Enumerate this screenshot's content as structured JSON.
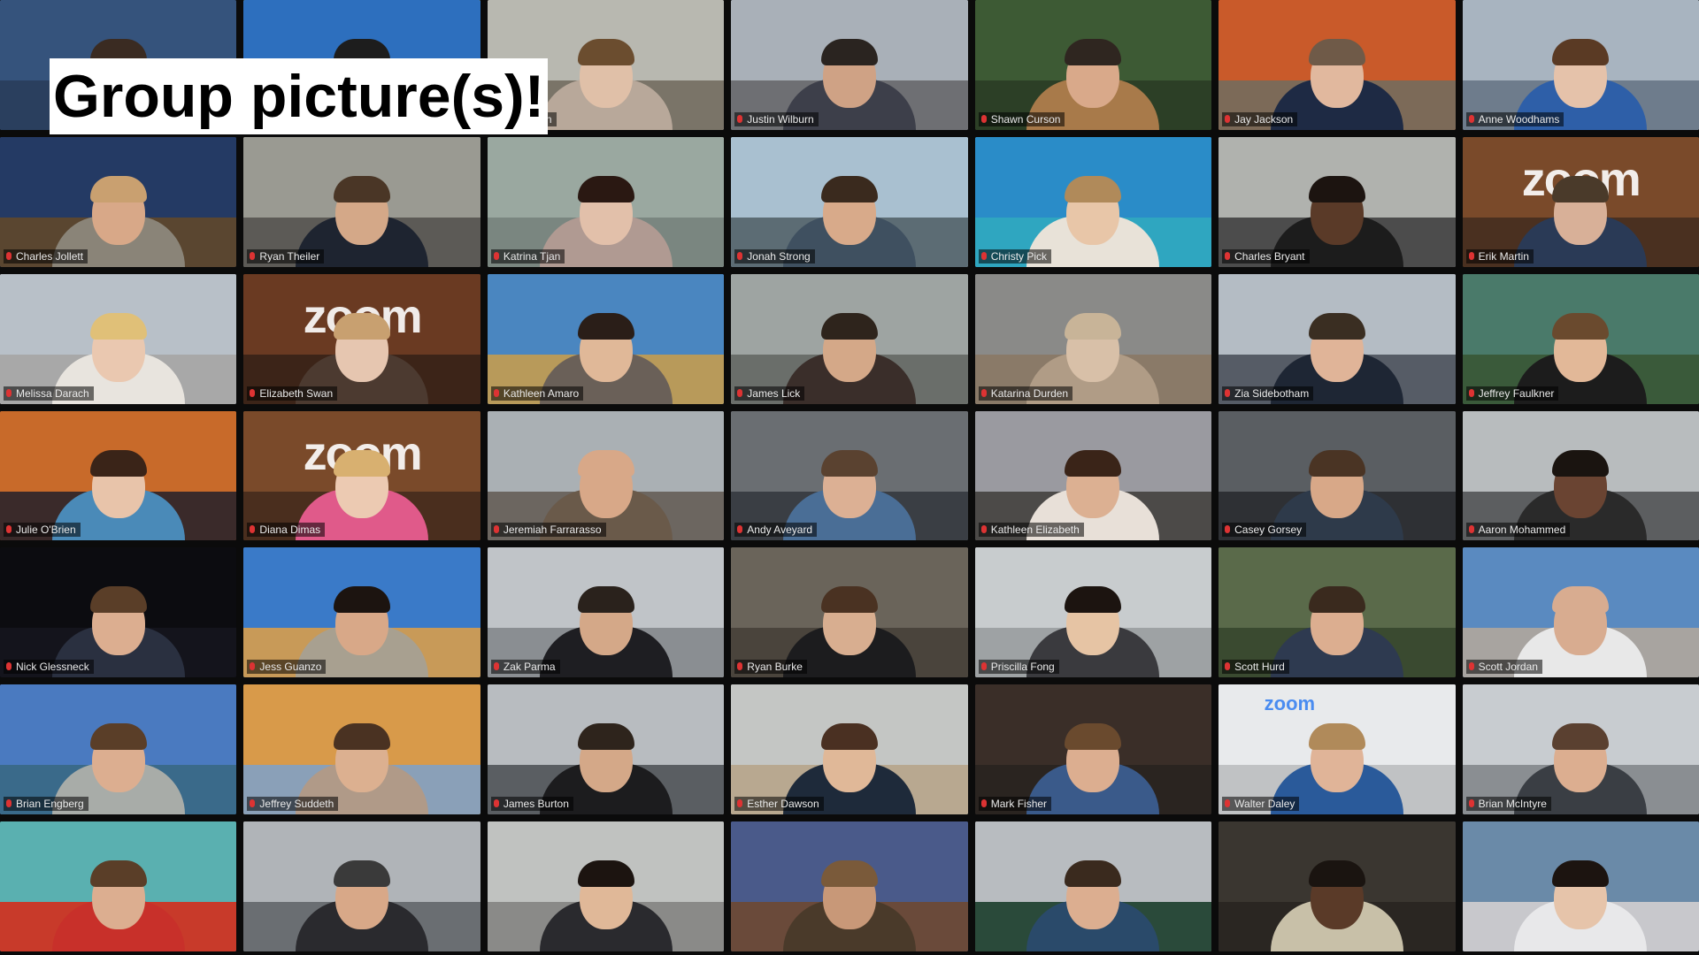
{
  "caption": "Group picture(s)!",
  "brand_text": "zoom",
  "accent_color": "#d8e23a",
  "grid": {
    "columns": 7,
    "rows": 7,
    "active_index": 1,
    "tiles": [
      {
        "name": "",
        "bg": "#35537c",
        "floor": "#2a3f5e",
        "skin": "#d9b09a",
        "hair": "#3a2b22",
        "shirt": "#2b2b30"
      },
      {
        "name": "",
        "bg": "#2d6fbe",
        "floor": "#23538c",
        "skin": "#d4a88c",
        "hair": "#1d1d1d",
        "shirt": "#f2f2f2"
      },
      {
        "name": "Hansagen",
        "bg": "#b8b8b0",
        "floor": "#7a7468",
        "skin": "#e0c0a8",
        "hair": "#6b4d2f",
        "shirt": "#b8a89a"
      },
      {
        "name": "Justin Wilburn",
        "bg": "#a9b0b8",
        "floor": "#6e6f73",
        "skin": "#cfa285",
        "hair": "#2a2420",
        "shirt": "#3d3f4a"
      },
      {
        "name": "Shawn Curson",
        "bg": "#3d5a34",
        "floor": "#2c3f26",
        "skin": "#d9a98a",
        "hair": "#2f2620",
        "shirt": "#a87a4a"
      },
      {
        "name": "Jay Jackson",
        "bg": "#c95a2a",
        "floor": "#7c6a58",
        "skin": "#e1b89e",
        "hair": "#6f5a48",
        "shirt": "#1e2a44"
      },
      {
        "name": "Anne Woodhams",
        "bg": "#a8b4c0",
        "floor": "#6e7c8c",
        "skin": "#e5c2aa",
        "hair": "#5a3a24",
        "shirt": "#2e5fa8"
      },
      {
        "name": "Charles Jollett",
        "bg": "#243a64",
        "floor": "#5a4630",
        "skin": "#d8a888",
        "hair": "#c9a070",
        "shirt": "#8a8478"
      },
      {
        "name": "Ryan Theiler",
        "bg": "#9a9a92",
        "floor": "#5c5a56",
        "skin": "#d4a888",
        "hair": "#4a3626",
        "shirt": "#1e2430"
      },
      {
        "name": "Katrina Tjan",
        "bg": "#9aa8a0",
        "floor": "#7a8680",
        "skin": "#e2c0aa",
        "hair": "#2a1812",
        "shirt": "#b09a92"
      },
      {
        "name": "Jonah Strong",
        "bg": "#a9c0d0",
        "floor": "#5c6c74",
        "skin": "#d8aa8a",
        "hair": "#3a2a1e",
        "shirt": "#3f5060"
      },
      {
        "name": "Christy Pick",
        "bg": "#2a8cc8",
        "floor": "#2fa6c0",
        "skin": "#e8c6a8",
        "hair": "#b08a5a",
        "shirt": "#e8e2d8"
      },
      {
        "name": "Charles Bryant",
        "bg": "#b0b2ae",
        "floor": "#4c4c4c",
        "skin": "#5a3a28",
        "hair": "#1c1410",
        "shirt": "#1c1c1c"
      },
      {
        "name": "Erik Martin",
        "bg": "#7a4a2a",
        "floor": "#4a3020",
        "skin": "#d8b098",
        "hair": "#4a3a2a",
        "shirt": "#2a3a56",
        "brand": true
      },
      {
        "name": "Melissa Darach",
        "bg": "#b8c0c8",
        "floor": "#a8a8a8",
        "skin": "#eac8b0",
        "hair": "#e0c078",
        "shirt": "#e8e4de"
      },
      {
        "name": "Elizabeth Swan",
        "bg": "#6a3a22",
        "floor": "#3c2418",
        "skin": "#e6c6b0",
        "hair": "#c8a070",
        "shirt": "#4c3a30",
        "brand": true
      },
      {
        "name": "Kathleen Amaro",
        "bg": "#4a86c0",
        "floor": "#b89a5a",
        "skin": "#e0b898",
        "hair": "#2a1e18",
        "shirt": "#6a6058"
      },
      {
        "name": "James Lick",
        "bg": "#9ea4a2",
        "floor": "#6a6e6a",
        "skin": "#d4a888",
        "hair": "#2e241c",
        "shirt": "#3a2e2a"
      },
      {
        "name": "Katarina Durden",
        "bg": "#8a8a88",
        "floor": "#8a7a68",
        "skin": "#d8c0a8",
        "hair": "#c8b498",
        "shirt": "#b09c86"
      },
      {
        "name": "Zia Sidebotham",
        "bg": "#b4bcc4",
        "floor": "#565c66",
        "skin": "#e0b498",
        "hair": "#3a2e22",
        "shirt": "#1e2634"
      },
      {
        "name": "Jeffrey Faulkner",
        "bg": "#4a7a6a",
        "floor": "#3a5a3a",
        "skin": "#e2b898",
        "hair": "#6a4a2e",
        "shirt": "#1c1c1c"
      },
      {
        "name": "Julie O'Brien",
        "bg": "#c86a2a",
        "floor": "#3a2a2a",
        "skin": "#e8c4aa",
        "hair": "#3a2418",
        "shirt": "#4a8ab8"
      },
      {
        "name": "Diana Dimas",
        "bg": "#7a4a2a",
        "floor": "#4a2e1e",
        "skin": "#eccab2",
        "hair": "#d8b070",
        "shirt": "#e05a8a",
        "brand": true
      },
      {
        "name": "Jeremiah Farrarasso",
        "bg": "#aab0b4",
        "floor": "#6c6660",
        "skin": "#d8a888",
        "hair": "#d8a888",
        "shirt": "#6a5a4a"
      },
      {
        "name": "Andy Aveyard",
        "bg": "#6a6e72",
        "floor": "#3a3e44",
        "skin": "#dcb094",
        "hair": "#5a4230",
        "shirt": "#4a6e96"
      },
      {
        "name": "Kathleen Elizabeth",
        "bg": "#9a9aa0",
        "floor": "#4c4a48",
        "skin": "#dcb092",
        "hair": "#3a2418",
        "shirt": "#e8e0d8"
      },
      {
        "name": "Casey Gorsey",
        "bg": "#5a5e62",
        "floor": "#2e3034",
        "skin": "#d8a888",
        "hair": "#4a3424",
        "shirt": "#2e3a4a"
      },
      {
        "name": "Aaron Mohammed",
        "bg": "#b8bcbe",
        "floor": "#5c5e60",
        "skin": "#6a4432",
        "hair": "#1a1410",
        "shirt": "#2a2a2a"
      },
      {
        "name": "Nick Glessneck",
        "bg": "#0c0c10",
        "floor": "#14141c",
        "skin": "#dcae90",
        "hair": "#5a3e28",
        "shirt": "#2a3040"
      },
      {
        "name": "Jess Guanzo",
        "bg": "#3a7ac8",
        "floor": "#c89a58",
        "skin": "#d8a888",
        "hair": "#1c1410",
        "shirt": "#a8a090"
      },
      {
        "name": "Zak Parma",
        "bg": "#c0c4c8",
        "floor": "#8a8e92",
        "skin": "#d4a888",
        "hair": "#2a221c",
        "shirt": "#1e1e22"
      },
      {
        "name": "Ryan Burke",
        "bg": "#6a645a",
        "floor": "#4a443c",
        "skin": "#d8ae90",
        "hair": "#4a3222",
        "shirt": "#1c1c1e"
      },
      {
        "name": "Priscilla Fong",
        "bg": "#c8ccce",
        "floor": "#9ea2a4",
        "skin": "#e6c4a4",
        "hair": "#1c1410",
        "shirt": "#3a3a3e"
      },
      {
        "name": "Scott Hurd",
        "bg": "#5a6a4a",
        "floor": "#3a4a30",
        "skin": "#dcae90",
        "hair": "#3a2a1e",
        "shirt": "#2e3a50"
      },
      {
        "name": "Scott Jordan",
        "bg": "#5a8ac0",
        "floor": "#a8a4a0",
        "skin": "#d8ac90",
        "hair": "#d8ac90",
        "shirt": "#e8e8e8"
      },
      {
        "name": "Brian Engberg",
        "bg": "#4a7ac0",
        "floor": "#3a6a8a",
        "skin": "#dcae90",
        "hair": "#5a3e28",
        "shirt": "#a8aca8"
      },
      {
        "name": "Jeffrey Suddeth",
        "bg": "#d89a4a",
        "floor": "#8aa0b8",
        "skin": "#dcb090",
        "hair": "#4a3222",
        "shirt": "#b09a88"
      },
      {
        "name": "James Burton",
        "bg": "#b8bcc0",
        "floor": "#5a5e62",
        "skin": "#d4a888",
        "hair": "#2e241c",
        "shirt": "#1c1c1e"
      },
      {
        "name": "Esther Dawson",
        "bg": "#c4c6c4",
        "floor": "#b8a890",
        "skin": "#e0b898",
        "hair": "#4a3022",
        "shirt": "#1e2a3a"
      },
      {
        "name": "Mark Fisher",
        "bg": "#3a2e28",
        "floor": "#2a2420",
        "skin": "#dcae90",
        "hair": "#6a4a2e",
        "shirt": "#3a5a8a"
      },
      {
        "name": "Walter Daley",
        "bg": "#e8eaec",
        "floor": "#c0c2c4",
        "skin": "#e0b498",
        "hair": "#b08a5a",
        "shirt": "#2a5a9a",
        "brand_small": true
      },
      {
        "name": "Brian McIntyre",
        "bg": "#c8ccd0",
        "floor": "#8a8e92",
        "skin": "#dcae90",
        "hair": "#5a4030",
        "shirt": "#3a3e44"
      },
      {
        "name": "",
        "bg": "#5ab0b0",
        "floor": "#c83a2a",
        "skin": "#dcae90",
        "hair": "#5a3e28",
        "shirt": "#c8302a"
      },
      {
        "name": "",
        "bg": "#b0b4b8",
        "floor": "#6a6e72",
        "skin": "#d8a888",
        "hair": "#3a3a3a",
        "shirt": "#2a2a2e"
      },
      {
        "name": "",
        "bg": "#c0c2c0",
        "floor": "#8a8a88",
        "skin": "#e0b898",
        "hair": "#1c1410",
        "shirt": "#2a2a2e"
      },
      {
        "name": "",
        "bg": "#4a5a8a",
        "floor": "#6a4a3a",
        "skin": "#c89878",
        "hair": "#7a5a3a",
        "shirt": "#4a3a2a"
      },
      {
        "name": "",
        "bg": "#b8bcc0",
        "floor": "#2a4a3a",
        "skin": "#dcae90",
        "hair": "#3a2a1e",
        "shirt": "#2a4a6a"
      },
      {
        "name": "",
        "bg": "#3a3630",
        "floor": "#2a2622",
        "skin": "#5a3a28",
        "hair": "#1a1410",
        "shirt": "#c8c0a8"
      },
      {
        "name": "",
        "bg": "#6a8aa8",
        "floor": "#c8c8cc",
        "skin": "#e6c4aa",
        "hair": "#1c1410",
        "shirt": "#e8e8ea"
      }
    ]
  }
}
